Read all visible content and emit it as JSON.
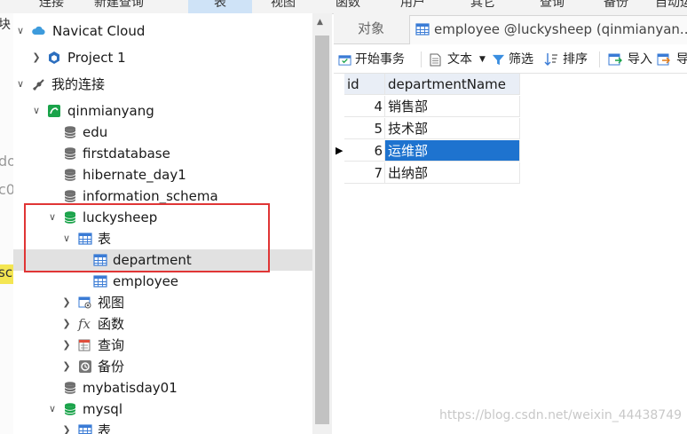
{
  "top_toolbar": {
    "items": [
      "连接",
      "新建查询",
      "表",
      "视图",
      "函数",
      "用户",
      "其它",
      "查询",
      "备份",
      "自动运"
    ]
  },
  "left_edge": {
    "fragments": [
      "块",
      "do",
      "c0",
      "sc"
    ]
  },
  "navigator": {
    "navicat_cloud": "Navicat Cloud",
    "project": "Project 1",
    "my_connections": "我的连接",
    "connection": "qinmianyang",
    "databases": {
      "edu": "edu",
      "firstdatabase": "firstdatabase",
      "hibernate_day1": "hibernate_day1",
      "information_schema": "information_schema",
      "luckysheep": "luckysheep",
      "mybatisday01": "mybatisday01",
      "mysql": "mysql"
    },
    "tables_label": "表",
    "tables": [
      "department",
      "employee"
    ],
    "views_label": "视图",
    "functions_label": "函数",
    "queries_label": "查询",
    "backups_label": "备份",
    "mysql_tables_label": "表"
  },
  "tabs": {
    "objects": "对象",
    "employee": "employee @luckysheep (qinmianyan..."
  },
  "grid_toolbar": {
    "begin_transaction": "开始事务",
    "text": "文本",
    "filter": "筛选",
    "sort": "排序",
    "import": "导入",
    "export": "导"
  },
  "grid": {
    "columns": [
      "id",
      "departmentName"
    ],
    "rows": [
      {
        "id": "4",
        "name": "销售部"
      },
      {
        "id": "5",
        "name": "技术部"
      },
      {
        "id": "6",
        "name": "运维部"
      },
      {
        "id": "7",
        "name": "出纳部"
      }
    ],
    "selected_row_index": 2
  },
  "watermark": "https://blog.csdn.net/weixin_44438749",
  "colors": {
    "selection": "#1e73cf",
    "highlight_box": "#e03535",
    "db_green": "#1aa34a",
    "table_blue": "#3a7bd5"
  }
}
